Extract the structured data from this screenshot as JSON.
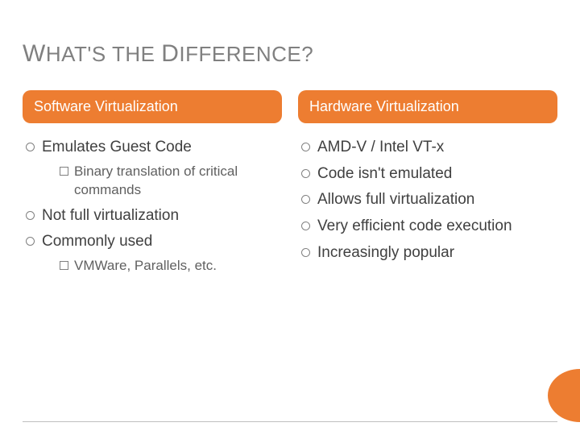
{
  "title": {
    "w": "W",
    "hat": "HAT",
    "apos_s": "'S",
    "the": " THE ",
    "d": "D",
    "ifference": "IFFERENCE",
    "q": "?"
  },
  "left": {
    "heading": "Software Virtualization",
    "items": [
      {
        "text": "Emulates Guest Code",
        "sub": [
          "Binary translation of critical commands"
        ]
      },
      {
        "text": "Not full virtualization"
      },
      {
        "text": "Commonly used",
        "sub": [
          "VMWare, Parallels, etc."
        ]
      }
    ]
  },
  "right": {
    "heading": "Hardware Virtualization",
    "items": [
      {
        "text": "AMD-V / Intel VT-x"
      },
      {
        "text": "Code isn't emulated"
      },
      {
        "text": "Allows full virtualization"
      },
      {
        "text": "Very efficient code execution"
      },
      {
        "text": "Increasingly popular"
      }
    ]
  }
}
